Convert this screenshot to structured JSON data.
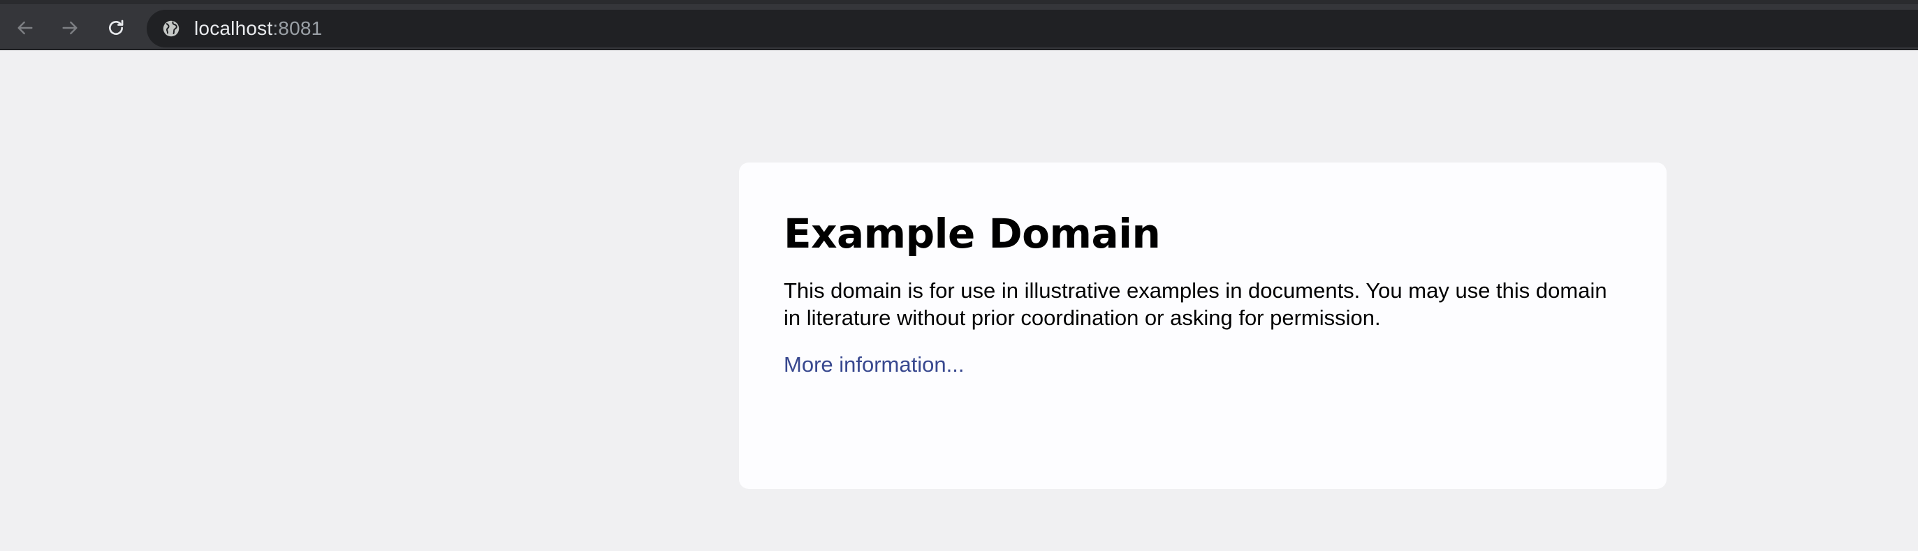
{
  "browser": {
    "url_host": "localhost",
    "url_port": ":8081",
    "icons": {
      "back": "arrow-left-icon",
      "forward": "arrow-right-icon",
      "reload": "reload-icon",
      "site_info": "globe-icon"
    },
    "colors": {
      "toolbar": "#35363a",
      "omnibox": "#202124",
      "host_text": "#e8eaed",
      "port_text": "#9aa0a6"
    }
  },
  "page": {
    "title": "Example Domain",
    "body": "This domain is for use in illustrative examples in documents. You may use this domain in literature without prior coordination or asking for permission.",
    "link_label": "More information...",
    "colors": {
      "background": "#f0f0f2",
      "card": "#fdfdff",
      "link": "#38488f"
    }
  }
}
